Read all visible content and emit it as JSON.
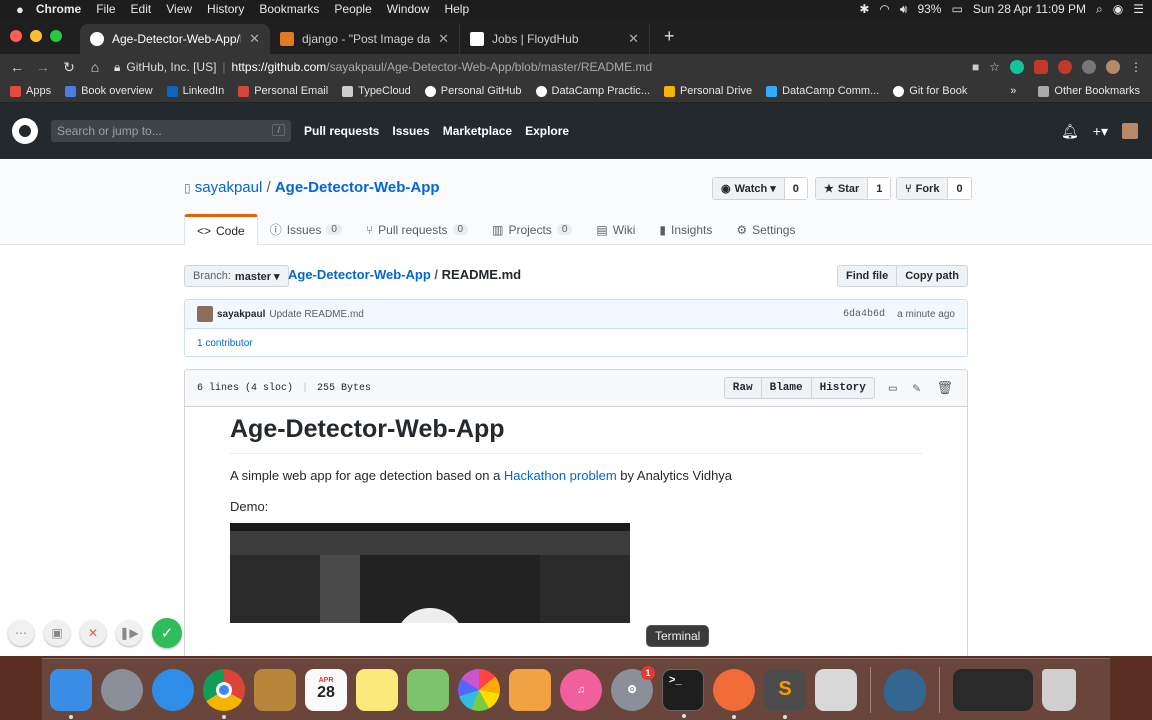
{
  "menubar": {
    "apple": "",
    "items": [
      "Chrome",
      "File",
      "Edit",
      "View",
      "History",
      "Bookmarks",
      "People",
      "Window",
      "Help"
    ],
    "battery": "93%",
    "datetime": "Sun 28 Apr  11:09 PM"
  },
  "tabs": [
    {
      "title": "Age-Detector-Web-App/READM",
      "favicon_color": "#ffffff"
    },
    {
      "title": "django - \"Post Image data usin",
      "favicon_color": "#e07b24"
    },
    {
      "title": "Jobs | FloydHub",
      "favicon_color": "#ffffff"
    }
  ],
  "address": {
    "security": "GitHub, Inc. [US]",
    "url_host": "https://github.com",
    "url_path": "/sayakpaul/Age-Detector-Web-App/blob/master/README.md"
  },
  "bookmarks": [
    {
      "label": "Apps",
      "color": "#e34b3b"
    },
    {
      "label": "Book overview",
      "color": "#4a7fe0"
    },
    {
      "label": "LinkedIn",
      "color": "#0a66c2"
    },
    {
      "label": "Personal Email",
      "color": "#d44638"
    },
    {
      "label": "TypeCloud",
      "color": "#cccccc"
    },
    {
      "label": "Personal GitHub",
      "color": "#ffffff"
    },
    {
      "label": "DataCamp Practic...",
      "color": "#ffffff"
    },
    {
      "label": "Personal Drive",
      "color": "#f4b400"
    },
    {
      "label": "DataCamp Comm...",
      "color": "#33aaff"
    },
    {
      "label": "Git for Book",
      "color": "#ffffff"
    }
  ],
  "bookmarks_more": "»",
  "other_bookmarks": "Other Bookmarks",
  "github": {
    "search_placeholder": "Search or jump to...",
    "search_shortcut": "/",
    "nav": [
      "Pull requests",
      "Issues",
      "Marketplace",
      "Explore"
    ]
  },
  "repo": {
    "owner": "sayakpaul",
    "sep": "/",
    "name": "Age-Detector-Web-App",
    "watch_label": "Watch ▾",
    "watch_count": "0",
    "star_label": "Star",
    "star_count": "1",
    "fork_label": "Fork",
    "fork_count": "0",
    "tabs": [
      {
        "label": "Code",
        "count": ""
      },
      {
        "label": "Issues",
        "count": "0"
      },
      {
        "label": "Pull requests",
        "count": "0"
      },
      {
        "label": "Projects",
        "count": "0"
      },
      {
        "label": "Wiki",
        "count": ""
      },
      {
        "label": "Insights",
        "count": ""
      },
      {
        "label": "Settings",
        "count": ""
      }
    ]
  },
  "file_nav": {
    "branch_prefix": "Branch:",
    "branch": "master ▾",
    "repo_link": "Age-Detector-Web-App",
    "sep": "/",
    "file": "README.md",
    "find_file": "Find file",
    "copy_path": "Copy path"
  },
  "commit": {
    "author": "sayakpaul",
    "message": "Update README.md",
    "sha": "6da4b6d",
    "time": "a minute ago",
    "contributors": "1 contributor"
  },
  "file": {
    "lines": "6 lines (4 sloc)",
    "size": "255 Bytes",
    "raw": "Raw",
    "blame": "Blame",
    "history": "History"
  },
  "readme": {
    "title": "Age-Detector-Web-App",
    "desc_before": "A simple web app for age detection based on a ",
    "desc_link": "Hackathon problem",
    "desc_after": " by Analytics Vidhya",
    "demo_label": "Demo:"
  },
  "tooltip": "Terminal",
  "dock": [
    {
      "name": "Finder",
      "color": "#3a8ee6"
    },
    {
      "name": "Launchpad",
      "color": "#8a8f99"
    },
    {
      "name": "Safari",
      "color": "#2e8de6"
    },
    {
      "name": "Chrome",
      "color": "#f4f4f4"
    },
    {
      "name": "Notefile",
      "color": "#b8863b"
    },
    {
      "name": "Calendar",
      "color": "#fafafa",
      "text": "28",
      "sub": "APR"
    },
    {
      "name": "Notes",
      "color": "#fbe97a"
    },
    {
      "name": "Maps",
      "color": "#7cc36b"
    },
    {
      "name": "Photos",
      "color": "#f8f8f8"
    },
    {
      "name": "Pages",
      "color": "#f0a340"
    },
    {
      "name": "iTunes",
      "color": "#f35f9c"
    },
    {
      "name": "System Preferences",
      "color": "#8a8f99",
      "badge": "1"
    },
    {
      "name": "Terminal",
      "color": "#1e1e1e",
      "text": ">_"
    },
    {
      "name": "Postman",
      "color": "#ef6c36"
    },
    {
      "name": "Sublime Text",
      "color": "#4b4b4b"
    },
    {
      "name": "Photo Viewer",
      "color": "#d8d8d8"
    },
    {
      "name": "PostgreSQL",
      "color": "#336791"
    },
    {
      "name": "Desktop",
      "color": "#2a2a2a"
    },
    {
      "name": "Trash",
      "color": "#cfcfcf"
    }
  ]
}
